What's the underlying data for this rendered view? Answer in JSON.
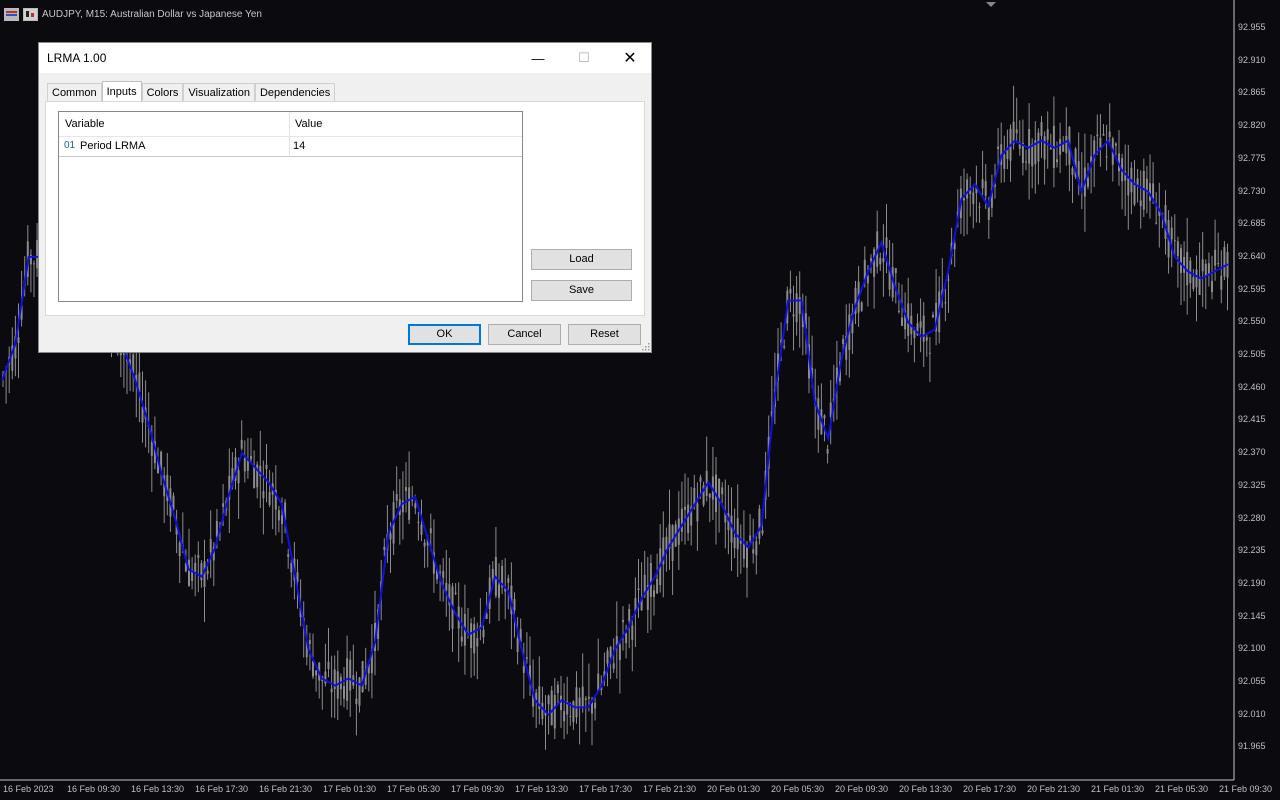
{
  "chart": {
    "icons": [
      "grid-icon",
      "chart-icon"
    ],
    "title": "AUDJPY, M15:  Australian Dollar vs Japanese Yen",
    "price_labels": [
      "92.955",
      "92.910",
      "92.865",
      "92.820",
      "92.775",
      "92.730",
      "92.685",
      "92.640",
      "92.595",
      "92.550",
      "92.505",
      "92.460",
      "92.415",
      "92.370",
      "92.325",
      "92.280",
      "92.235",
      "92.190",
      "92.145",
      "92.100",
      "92.055",
      "92.010",
      "91.965"
    ],
    "time_labels": [
      "16 Feb 2023",
      "16 Feb 09:30",
      "16 Feb 13:30",
      "16 Feb 17:30",
      "16 Feb 21:30",
      "17 Feb 01:30",
      "17 Feb 05:30",
      "17 Feb 09:30",
      "17 Feb 13:30",
      "17 Feb 17:30",
      "17 Feb 21:30",
      "20 Feb 01:30",
      "20 Feb 05:30",
      "20 Feb 09:30",
      "20 Feb 13:30",
      "20 Feb 17:30",
      "20 Feb 21:30",
      "21 Feb 01:30",
      "21 Feb 05:30",
      "21 Feb 09:30"
    ],
    "background": "#0a0a0f",
    "candle_color": "#8c8c8c",
    "lrma_color": "#1010e0",
    "lrma_values": [
      92.47,
      92.52,
      92.64,
      92.64,
      92.61,
      92.6,
      92.62,
      92.58,
      92.56,
      92.52,
      92.47,
      92.41,
      92.34,
      92.28,
      92.21,
      92.2,
      92.24,
      92.31,
      92.37,
      92.35,
      92.33,
      92.3,
      92.2,
      92.1,
      92.06,
      92.05,
      92.06,
      92.05,
      92.11,
      92.26,
      92.3,
      92.31,
      92.25,
      92.19,
      92.15,
      92.12,
      92.13,
      92.2,
      92.18,
      92.1,
      92.03,
      92.01,
      92.03,
      92.02,
      92.02,
      92.05,
      92.1,
      92.13,
      92.17,
      92.2,
      92.24,
      92.27,
      92.3,
      92.33,
      92.3,
      92.26,
      92.24,
      92.27,
      92.45,
      92.58,
      92.58,
      92.44,
      92.39,
      92.5,
      92.57,
      92.62,
      92.66,
      92.6,
      92.55,
      92.53,
      92.54,
      92.62,
      92.72,
      92.74,
      92.71,
      92.78,
      92.8,
      92.79,
      92.8,
      92.79,
      92.8,
      92.73,
      92.78,
      92.8,
      92.76,
      92.74,
      92.73,
      92.7,
      92.64,
      92.62,
      92.61,
      92.62,
      92.63
    ]
  },
  "dialog": {
    "title": "LRMA 1.00",
    "controls": {
      "minimize": "—",
      "maximize": "☐",
      "close": "✕"
    },
    "tabs": [
      "Common",
      "Inputs",
      "Colors",
      "Visualization",
      "Dependencies"
    ],
    "active_tab": "Inputs",
    "grid": {
      "headers": [
        "Variable",
        "Value"
      ],
      "rows": [
        {
          "icon": "01",
          "variable": "Period LRMA",
          "value": "14"
        }
      ]
    },
    "side_buttons": [
      "Load",
      "Save"
    ],
    "bottom_buttons": [
      "OK",
      "Cancel",
      "Reset"
    ]
  }
}
